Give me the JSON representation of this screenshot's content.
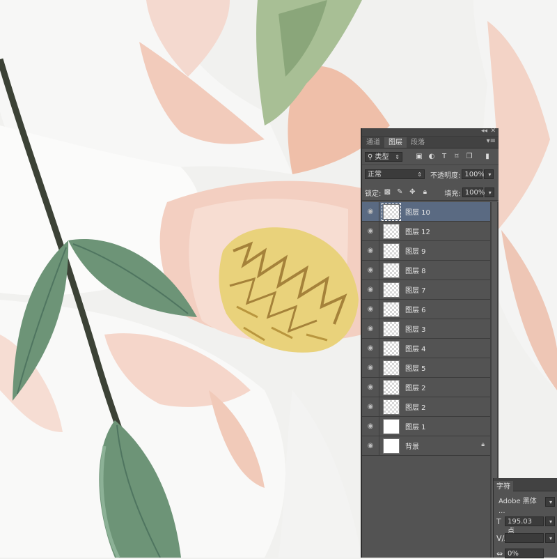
{
  "panel": {
    "tabs": [
      "通道",
      "图层",
      "段落"
    ],
    "active_tab": "图层",
    "filter_kind": "类型",
    "blend_mode": "正常",
    "opacity_label": "不透明度:",
    "opacity_value": "100%",
    "lock_label": "锁定:",
    "fill_label": "填充:",
    "fill_value": "100%",
    "layers": [
      {
        "name": "图层 10",
        "selected": true
      },
      {
        "name": "图层 12"
      },
      {
        "name": "图层 9"
      },
      {
        "name": "图层 8"
      },
      {
        "name": "图层 7"
      },
      {
        "name": "图层 6"
      },
      {
        "name": "图层 3"
      },
      {
        "name": "图层 4"
      },
      {
        "name": "图层 5"
      },
      {
        "name": "图层 2"
      },
      {
        "name": "图层 2"
      },
      {
        "name": "图层 1"
      },
      {
        "name": "背景"
      }
    ]
  },
  "character_panel": {
    "tab": "字符",
    "font": "Adobe 黑体 ...",
    "size": "195.03 点",
    "tracking": "0%"
  },
  "colors": {
    "panel_bg": "#535353",
    "selected_layer": "#5a6a82",
    "leaf": "#6d9477",
    "stem": "#3c4236",
    "petal_pink": "#f3d1c4",
    "stamen_yellow": "#e8d27c"
  }
}
